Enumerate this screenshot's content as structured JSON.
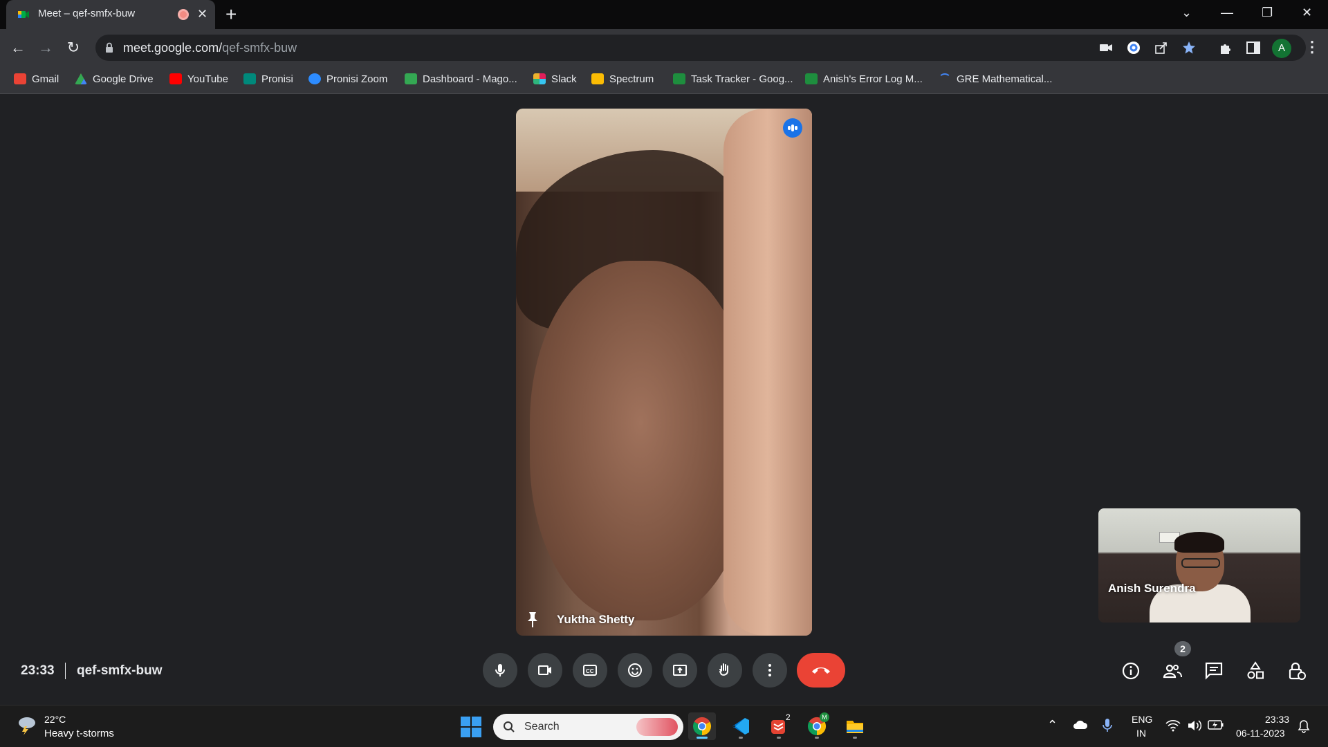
{
  "browser": {
    "tab": {
      "title": "Meet – qef-smfx-buw"
    },
    "url": {
      "host": "meet.google.com/",
      "path": "qef-smfx-buw"
    },
    "profile_initial": "A",
    "bookmarks": [
      {
        "label": "Gmail",
        "icon": "gmail-icon",
        "color": "#ea4335"
      },
      {
        "label": "Google Drive",
        "icon": "google-drive-icon",
        "color": "#34a853"
      },
      {
        "label": "YouTube",
        "icon": "youtube-icon",
        "color": "#ff0000"
      },
      {
        "label": "Pronisi",
        "icon": "meet-icon",
        "color": "#00897b"
      },
      {
        "label": "Pronisi Zoom",
        "icon": "zoom-icon",
        "color": "#2d8cff"
      },
      {
        "label": "Dashboard - Mago...",
        "icon": "dashboard-icon",
        "color": "#34a853"
      },
      {
        "label": "Slack",
        "icon": "slack-icon",
        "color": "#e01e5a"
      },
      {
        "label": "Spectrum",
        "icon": "spectrum-icon",
        "color": "#fbbc04"
      },
      {
        "label": "Task Tracker - Goog...",
        "icon": "sheets-icon",
        "color": "#1e8e3e"
      },
      {
        "label": "Anish's Error Log M...",
        "icon": "sheets-icon",
        "color": "#1e8e3e"
      },
      {
        "label": "GRE Mathematical...",
        "icon": "loading-icon",
        "color": "#4285f4"
      }
    ]
  },
  "meet": {
    "main_participant": "Yuktha Shetty",
    "self_participant": "Anish Surendra",
    "time": "23:33",
    "meeting_code": "qef-smfx-buw",
    "people_count": "2",
    "end_call_color": "#ea4335"
  },
  "taskbar": {
    "weather_temp": "22°C",
    "weather_desc": "Heavy t-storms",
    "search_placeholder": "Search",
    "todoist_badge": "2",
    "chrome_profile_badge": "M",
    "lang_line1": "ENG",
    "lang_line2": "IN",
    "clock_time": "23:33",
    "clock_date": "06-11-2023"
  }
}
